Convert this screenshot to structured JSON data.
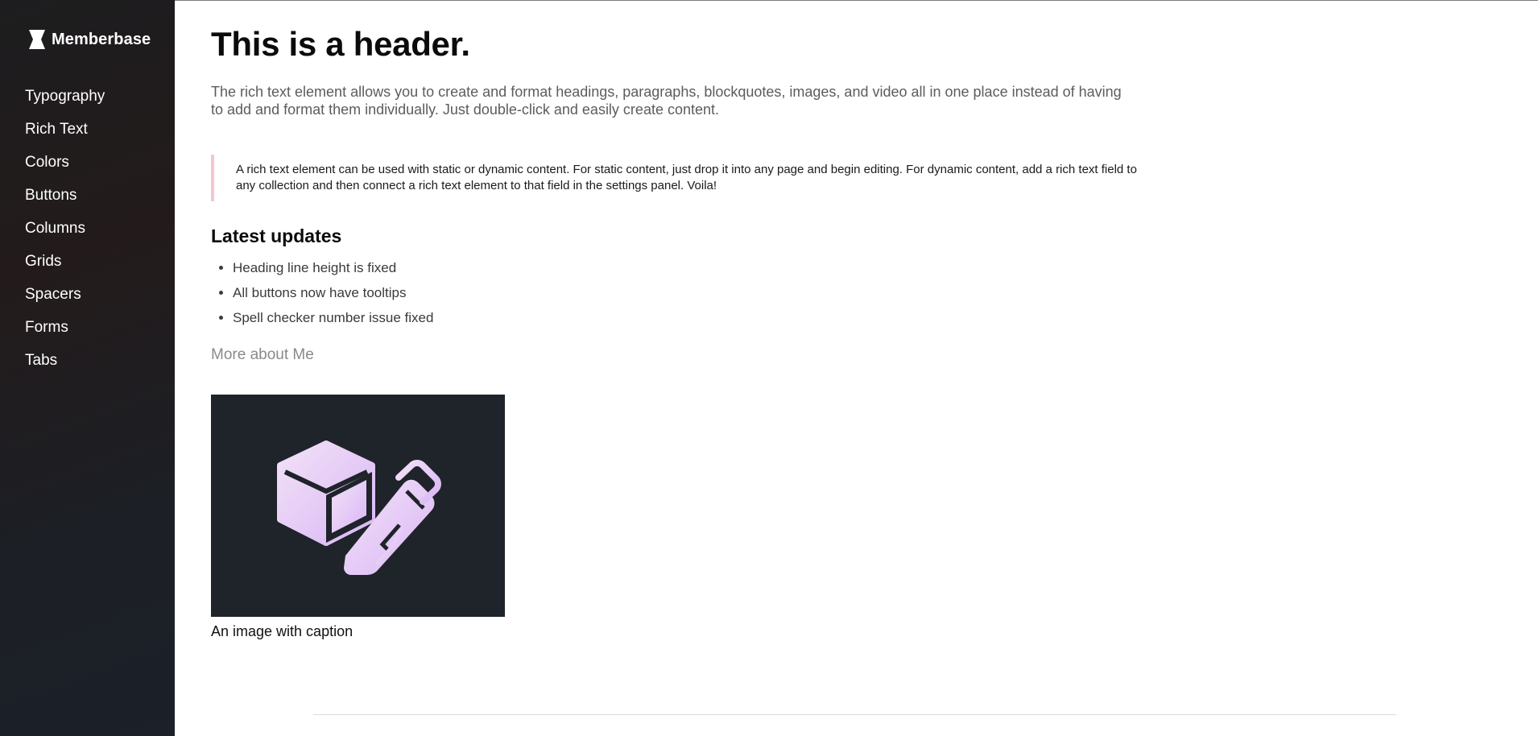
{
  "sidebar": {
    "brand": {
      "name": "Memberbase",
      "icon": "memberbase-logo-icon"
    },
    "items": [
      {
        "label": "Typography"
      },
      {
        "label": "Rich Text"
      },
      {
        "label": "Colors"
      },
      {
        "label": "Buttons"
      },
      {
        "label": "Columns"
      },
      {
        "label": "Grids"
      },
      {
        "label": "Spacers"
      },
      {
        "label": "Forms"
      },
      {
        "label": "Tabs"
      }
    ]
  },
  "main": {
    "title": "This is a header.",
    "lead": "The rich text element allows you to create and format headings, paragraphs, blockquotes, images, and video all in one place instead of having to add and format them individually. Just double-click and easily create content.",
    "blockquote": "A rich text element can be used with static or dynamic content. For static content, just drop it into any page and begin editing. For dynamic content, add a rich text field to any collection and then connect a rich text element to that field in the settings panel. Voila!",
    "updates_heading": "Latest updates",
    "updates": [
      "Heading line height is fixed",
      "All buttons now have tooltips",
      "Spell checker number issue fixed"
    ],
    "more_link": "More about Me",
    "figure": {
      "caption": "An image with caption",
      "icon": "cube-pencil-icon"
    }
  },
  "colors": {
    "sidebar_bg": "#1e1f24",
    "quote_border": "#f6c6cf",
    "figure_bg": "#1f232a",
    "icon_gradient_start": "#f2e2f7",
    "icon_gradient_end": "#d9b6f5"
  }
}
